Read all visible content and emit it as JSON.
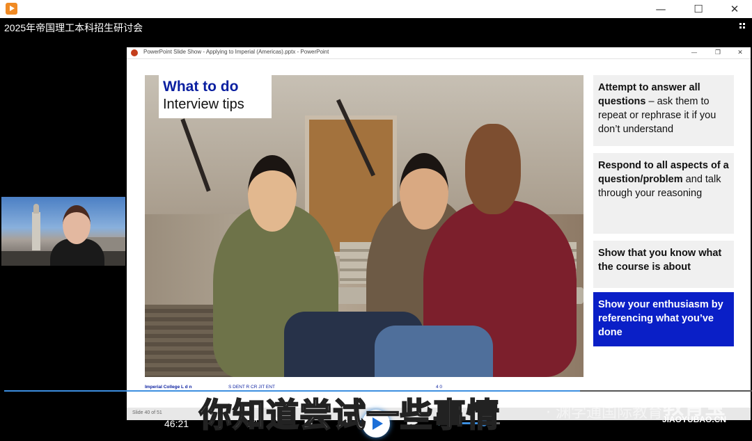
{
  "window": {
    "minimize": "—",
    "maximize": "☐",
    "close": "✕"
  },
  "player": {
    "title": "2025年帝国理工本科招生研讨会",
    "time": "46:21",
    "progress_fraction": 0.77,
    "volume_fraction": 0.6,
    "icons": [
      "loop-icon",
      "refresh-icon",
      "stop-icon",
      "rewind-icon",
      "play-icon",
      "fast-forward-icon",
      "volume-icon"
    ],
    "stop": "■",
    "rewind": "◀◀",
    "fast_forward": "▶▶",
    "volume": "🔊",
    "loop": "⤭",
    "refresh": "↻"
  },
  "powerpoint": {
    "title": "PowerPoint Slide Show  -  Applying to Imperial (Americas).pptx - PowerPoint",
    "minimize": "—",
    "restore": "❐",
    "close": "✕",
    "status": "Slide 40 of 51"
  },
  "slide": {
    "heading_line1": "What to do",
    "heading_line2": "Interview tips",
    "tips": [
      {
        "bold": "Attempt to answer all questions",
        "rest": " – ask them to repeat or rephrase it if you don’t understand"
      },
      {
        "bold": "Respond to all aspects of a question/problem",
        "rest": " and talk through your reasoning"
      },
      {
        "bold": "Show that you know what the course is about",
        "rest": ""
      },
      {
        "bold": "Show your enthusiasm by referencing what you’ve done",
        "rest": ""
      }
    ],
    "footer_left": "Imperial College L  d  n",
    "footer_mid": "S  DENT R CR  JIT  ENT",
    "footer_right": "4 0"
  },
  "subtitle": "你知道尝试一些事情",
  "watermark": {
    "text": "· 渊学通国际教育",
    "logo": "教育宝",
    "url": "JIAOYUBAO.CN"
  },
  "colors": {
    "imperial_blue": "#0a1fc7",
    "heading_blue": "#0a1fa0",
    "accent": "#3c8fe0"
  }
}
